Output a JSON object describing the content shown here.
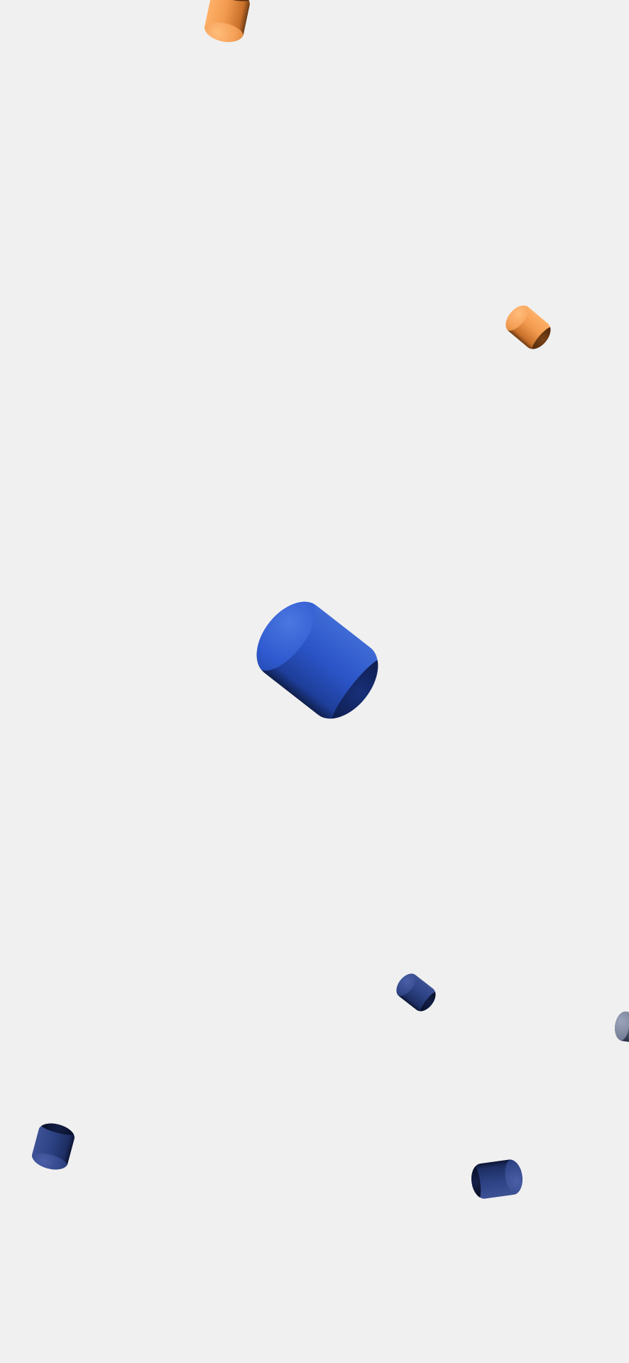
{
  "scene": {
    "background": "#f0f0f0",
    "palette": {
      "orange": "#f6a25a",
      "blue": "#2b55c8",
      "navy": "#2c4283",
      "gray": "#6d7790"
    },
    "objects": [
      {
        "kind": "cylinder",
        "color": "orange"
      },
      {
        "kind": "cylinder",
        "color": "orange"
      },
      {
        "kind": "cylinder",
        "color": "blue"
      },
      {
        "kind": "cylinder",
        "color": "navy"
      },
      {
        "kind": "cylinder",
        "color": "gray"
      },
      {
        "kind": "cylinder",
        "color": "navy"
      },
      {
        "kind": "cylinder",
        "color": "navy"
      }
    ]
  }
}
